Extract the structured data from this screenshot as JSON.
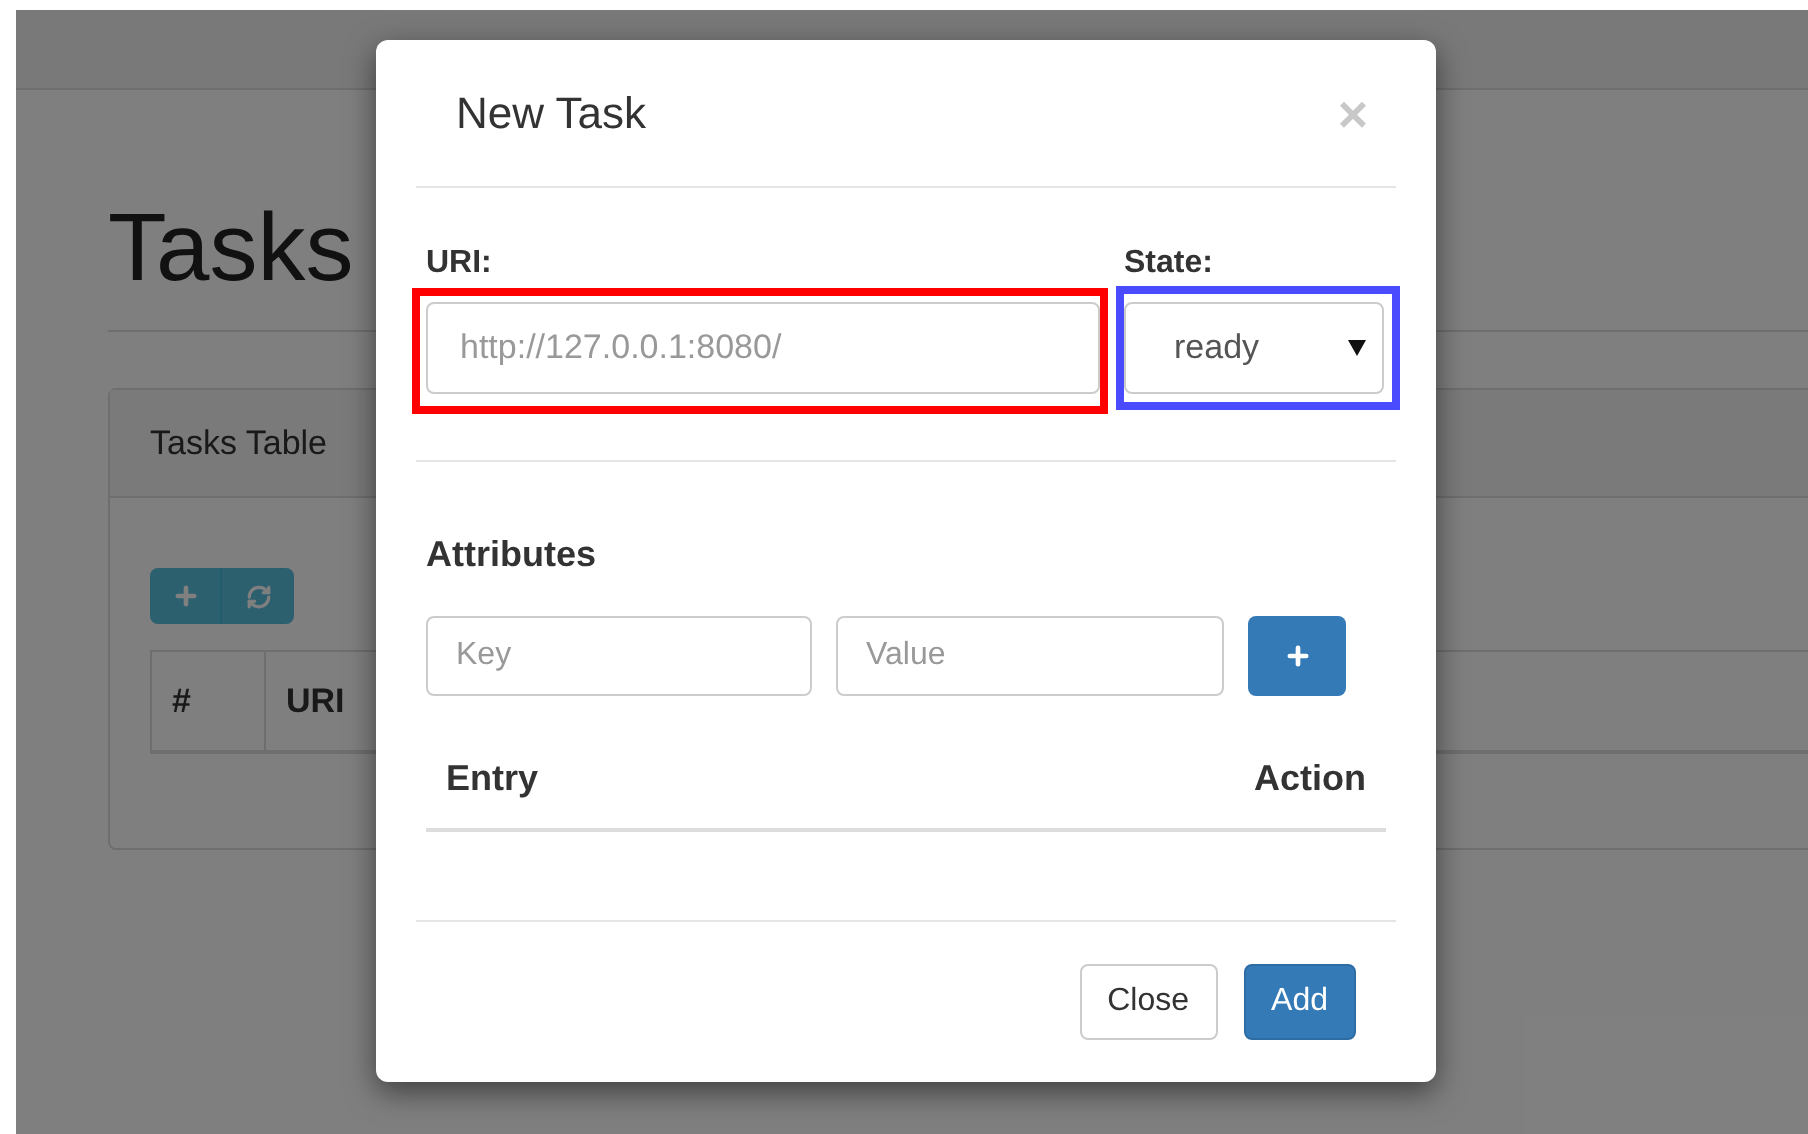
{
  "page": {
    "heading": "Tasks",
    "panel": {
      "title": "Tasks Table",
      "columns": [
        "#",
        "URI"
      ]
    }
  },
  "modal": {
    "title": "New Task",
    "close": "×",
    "uri": {
      "label": "URI:",
      "placeholder": "http://127.0.0.1:8080/",
      "color": "#ff0000"
    },
    "state": {
      "label": "State:",
      "value": "ready",
      "color": "#4a4aff"
    },
    "attributes": {
      "heading": "Attributes",
      "key_placeholder": "Key",
      "value_placeholder": "Value",
      "columns": [
        "Entry",
        "Action"
      ]
    },
    "buttons": [
      {
        "label": "Close",
        "kind": "default"
      },
      {
        "label": "Add",
        "kind": "primary"
      }
    ]
  }
}
